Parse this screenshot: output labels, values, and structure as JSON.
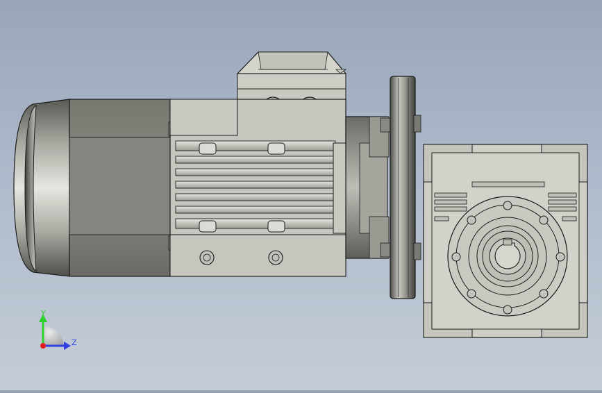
{
  "viewer": {
    "background_top": "#98a6b8",
    "background_bottom": "#c4ccd6"
  },
  "model": {
    "part_color": "#c8c8c0",
    "dark_color": "#6c6c66",
    "edge_color": "#1a1a1a"
  },
  "triad": {
    "y_label": "Y",
    "z_label": "Z",
    "y_color": "#2fd12f",
    "z_color": "#2f3fe0",
    "x_color": "#e02020"
  }
}
